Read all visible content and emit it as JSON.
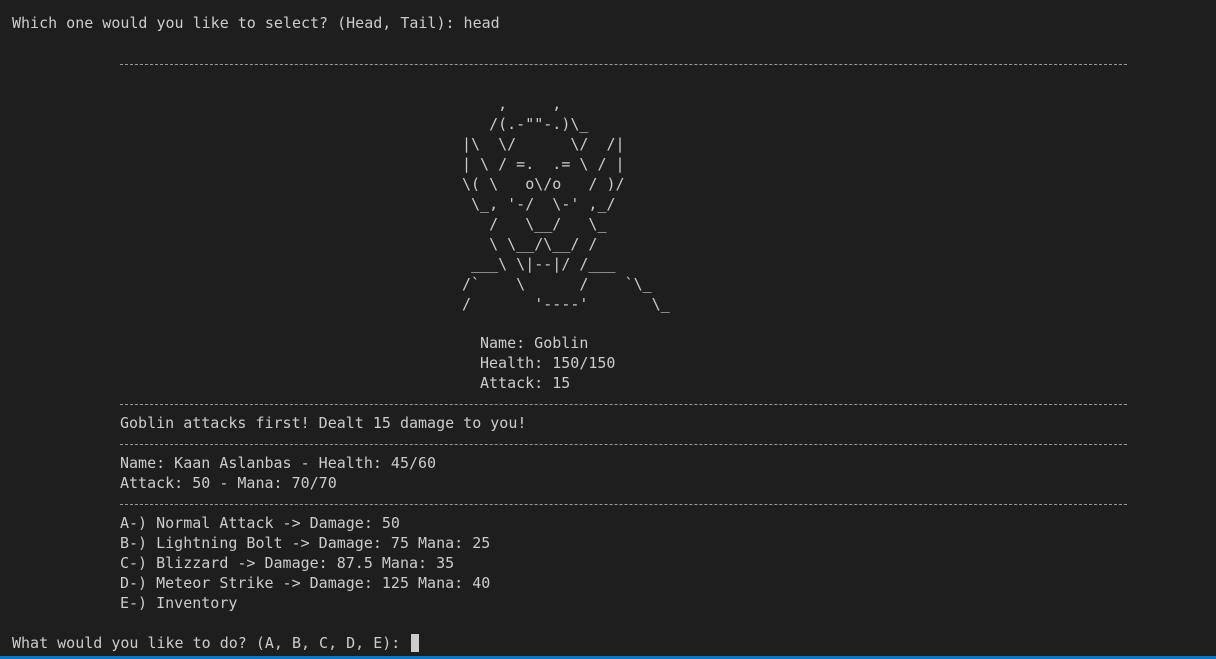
{
  "prompt_select": "Which one would you like to select? (Head, Tail): head",
  "goblin_art": "    ,     ,\n   /(.-\"\"-.)\\_\n|\\  \\/      \\/  /|\n| \\ / =.  .= \\ / |\n\\( \\   o\\/o   / )/\n \\_, '-/  \\-' ,_/\n   /   \\__/   \\_\n   \\ \\__/\\__/ /\n ___\\ \\|--|/ /___\n/`    \\      /    `\\_\n/       '----'       \\_",
  "enemy": {
    "name_line": "Name: Goblin",
    "health_line": "Health: 150/150",
    "attack_line": "Attack: 15"
  },
  "combat_message": "Goblin attacks first! Dealt 15 damage to you!",
  "player": {
    "line1": "Name: Kaan Aslanbas - Health: 45/60",
    "line2": "Attack: 50 - Mana: 70/70"
  },
  "options": [
    "A-) Normal Attack -> Damage: 50",
    "B-) Lightning Bolt -> Damage: 75 Mana: 25",
    "C-) Blizzard -> Damage: 87.5 Mana: 35",
    "D-) Meteor Strike -> Damage: 125 Mana: 40",
    "E-) Inventory"
  ],
  "prompt_action": "What would you like to do? (A, B, C, D, E): ",
  "colors": {
    "background": "#1e1e1e",
    "text": "#cccccc",
    "status_bar": "#007acc"
  }
}
